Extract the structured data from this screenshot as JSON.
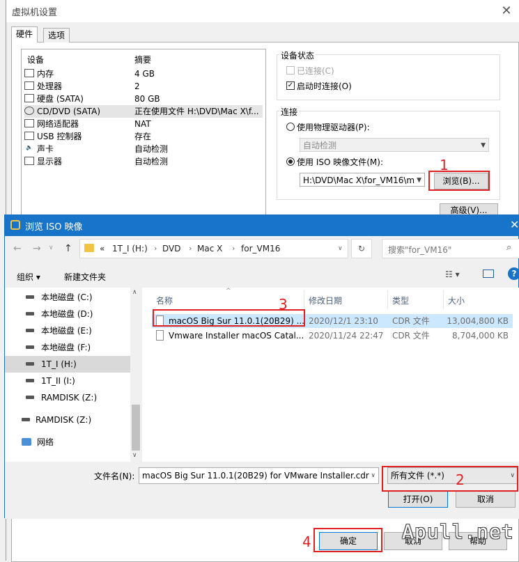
{
  "vm_dialog": {
    "title": "虚拟机设置",
    "tabs": [
      "硬件",
      "选项"
    ],
    "device_header": {
      "device": "设备",
      "summary": "摘要"
    },
    "devices": [
      {
        "icon": "memory-icon",
        "name": "内存",
        "summary": "4 GB"
      },
      {
        "icon": "cpu-icon",
        "name": "处理器",
        "summary": "2"
      },
      {
        "icon": "hdd-icon",
        "name": "硬盘 (SATA)",
        "summary": "80 GB"
      },
      {
        "icon": "cd-icon",
        "name": "CD/DVD (SATA)",
        "summary": "正在使用文件 H:\\DVD\\Mac X\\f..."
      },
      {
        "icon": "network-icon",
        "name": "网络适配器",
        "summary": "NAT"
      },
      {
        "icon": "usb-icon",
        "name": "USB 控制器",
        "summary": "存在"
      },
      {
        "icon": "sound-icon",
        "name": "声卡",
        "summary": "自动检测"
      },
      {
        "icon": "monitor-icon",
        "name": "显示器",
        "summary": "自动检测"
      }
    ],
    "device_status": {
      "label": "设备状态",
      "connected": "已连接(C)",
      "connect_at_power_on": "启动时连接(O)"
    },
    "connection": {
      "label": "连接",
      "physical_drive": "使用物理驱动器(P):",
      "auto_detect": "自动检测",
      "use_iso": "使用 ISO 映像文件(M):",
      "iso_path": "H:\\DVD\\Mac X\\for_VM16\\m",
      "browse": "浏览(B)...",
      "advanced": "高级(V)..."
    },
    "footer": {
      "ok": "确定",
      "cancel": "取消",
      "help": "帮助"
    }
  },
  "iso_dialog": {
    "title": "浏览 ISO 映像",
    "breadcrumb": [
      "«",
      "1T_I (H:)",
      "DVD",
      "Mac X",
      "for_VM16"
    ],
    "search_placeholder": "搜索\"for_VM16\"",
    "toolbar": {
      "organize": "组织",
      "new_folder": "新建文件夹"
    },
    "nav_items": [
      {
        "icon": "drive-icon",
        "label": "本地磁盘 (C:)"
      },
      {
        "icon": "drive-icon",
        "label": "本地磁盘 (D:)"
      },
      {
        "icon": "drive-icon",
        "label": "本地磁盘 (E:)"
      },
      {
        "icon": "drive-icon",
        "label": "本地磁盘 (F:)"
      },
      {
        "icon": "drive-icon",
        "label": "1T_I (H:)"
      },
      {
        "icon": "drive-icon",
        "label": "1T_II (I:)"
      },
      {
        "icon": "drive-icon",
        "label": "RAMDISK (Z:)"
      },
      {
        "icon": "drive-icon",
        "label": "RAMDISK (Z:)"
      },
      {
        "icon": "network-icon",
        "label": "网络"
      }
    ],
    "columns": {
      "name": "名称",
      "date": "修改日期",
      "type": "类型",
      "size": "大小"
    },
    "files": [
      {
        "name": "macOS Big Sur 11.0.1(20B29) ...",
        "date": "2020/12/1 23:10",
        "type": "CDR 文件",
        "size": "13,004,800 KB"
      },
      {
        "name": "Vmware Installer macOS Catal...",
        "date": "2020/11/24 22:47",
        "type": "CDR 文件",
        "size": "8,704,000 KB"
      }
    ],
    "filename_label": "文件名(N):",
    "filename_value": "macOS Big Sur 11.0.1(20B29) for VMware Installer.cdr",
    "filter_value": "所有文件 (*.*)",
    "open": "打开(O)",
    "cancel": "取消"
  },
  "annotations": [
    "1",
    "2",
    "3",
    "4"
  ],
  "watermark": "Apull.net",
  "colors": {
    "titlebar": "#1874c8",
    "selection": "#cce8ff",
    "annotation": "#e02020"
  }
}
